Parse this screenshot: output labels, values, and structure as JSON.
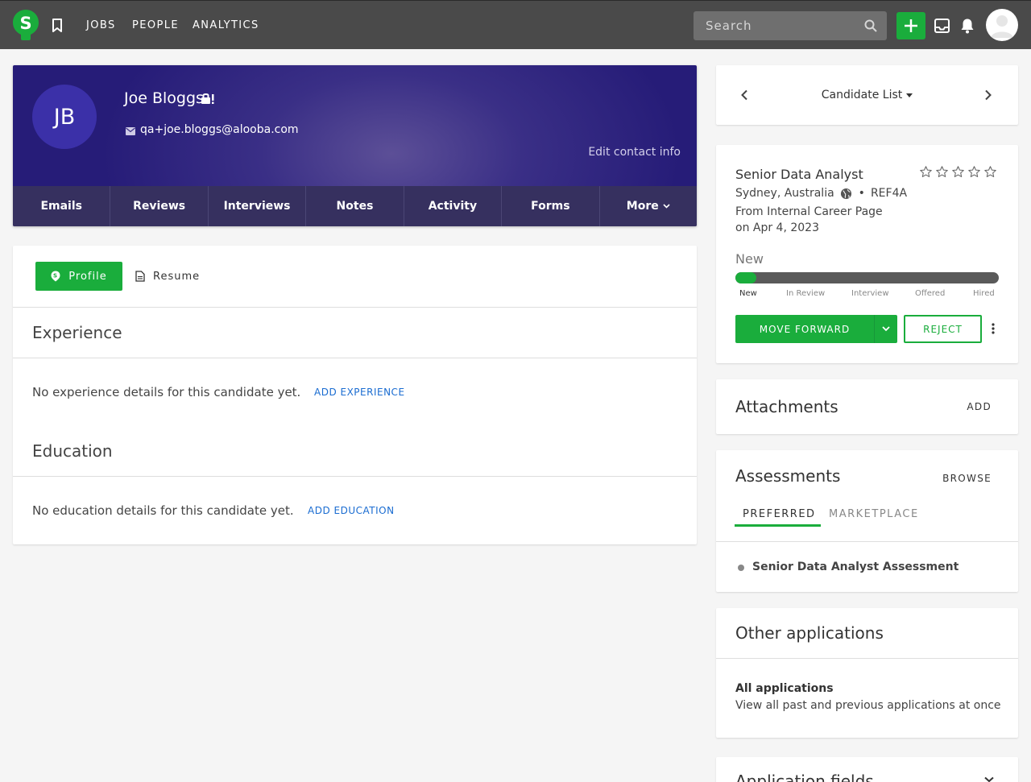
{
  "nav": {
    "links": [
      "JOBS",
      "PEOPLE",
      "ANALYTICS"
    ],
    "search_placeholder": "Search",
    "brand_letter": "S",
    "accent_color": "#1aad3c"
  },
  "candidate": {
    "initials": "JB",
    "name": "Joe Bloggs",
    "email": "qa+joe.bloggs@alooba.com",
    "edit_contact": "Edit contact info",
    "tabs": [
      "Emails",
      "Reviews",
      "Interviews",
      "Notes",
      "Activity",
      "Forms",
      "More"
    ]
  },
  "profile": {
    "profile_button": "Profile",
    "resume_button": "Resume",
    "experience_title": "Experience",
    "experience_empty": "No experience details for this candidate yet.",
    "add_experience": "ADD EXPERIENCE",
    "education_title": "Education",
    "education_empty": "No education details for this candidate yet.",
    "add_education": "ADD EDUCATION"
  },
  "candidate_list": {
    "label": "Candidate List"
  },
  "job": {
    "title": "Senior Data Analyst",
    "rating": 0,
    "location": "Sydney, Australia",
    "ref": "REF4A",
    "source": "From Internal Career Page",
    "date": "on Apr 4, 2023",
    "current_stage": "New",
    "stages": [
      "New",
      "In Review",
      "Interview",
      "Offered",
      "Hired"
    ],
    "progress_fraction": 0.08,
    "move_forward": "MOVE FORWARD",
    "reject": "REJECT"
  },
  "attachments": {
    "title": "Attachments",
    "action": "ADD"
  },
  "assessments": {
    "title": "Assessments",
    "action": "BROWSE",
    "tabs": [
      "PREFERRED",
      "MARKETPLACE"
    ],
    "items": [
      "Senior Data Analyst Assessment"
    ]
  },
  "other_applications": {
    "title": "Other applications",
    "all_title": "All applications",
    "all_desc": "View all past and previous applications at once"
  },
  "application_fields": {
    "title": "Application fields"
  }
}
